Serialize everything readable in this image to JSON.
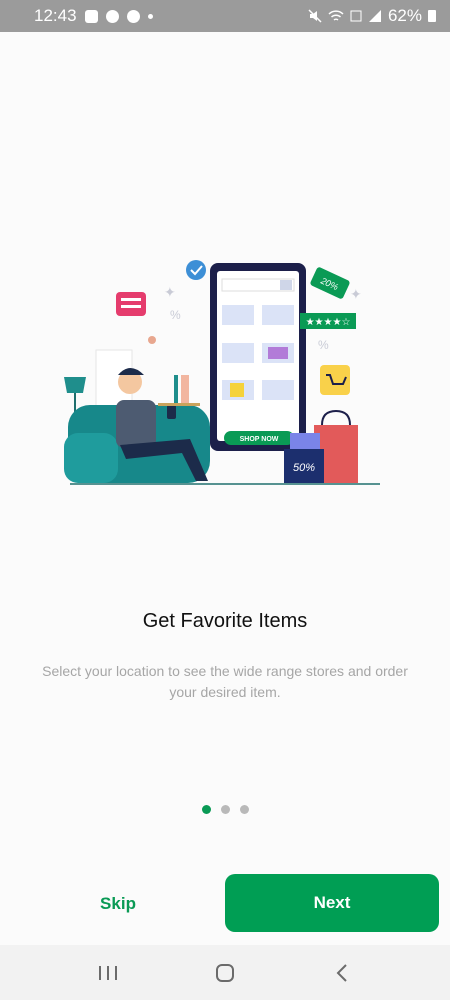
{
  "status_bar": {
    "time": "12:43",
    "battery": "62%",
    "left_icons": [
      "gallery-icon",
      "chat-bubble-icon",
      "whatsapp-icon",
      "dot-icon"
    ],
    "right_icons": [
      "mute-icon",
      "wifi-icon",
      "volte-icon",
      "signal-icon",
      "battery-icon"
    ]
  },
  "illustration": {
    "phone_button": "SHOP NOW",
    "discount_tag": "20%",
    "bag_label": "50%"
  },
  "onboarding": {
    "title": "Get Favorite Items",
    "description": "Select your location to see the wide range stores and order your desired item.",
    "page_count": 3,
    "active_page": 1
  },
  "actions": {
    "skip_label": "Skip",
    "next_label": "Next"
  },
  "colors": {
    "accent": "#009e54",
    "status_bar": "#9b9b9b",
    "background": "#fbfbfb",
    "description_text": "#a6a6a6"
  },
  "system_nav": [
    "recent-apps-icon",
    "home-icon",
    "back-icon"
  ]
}
